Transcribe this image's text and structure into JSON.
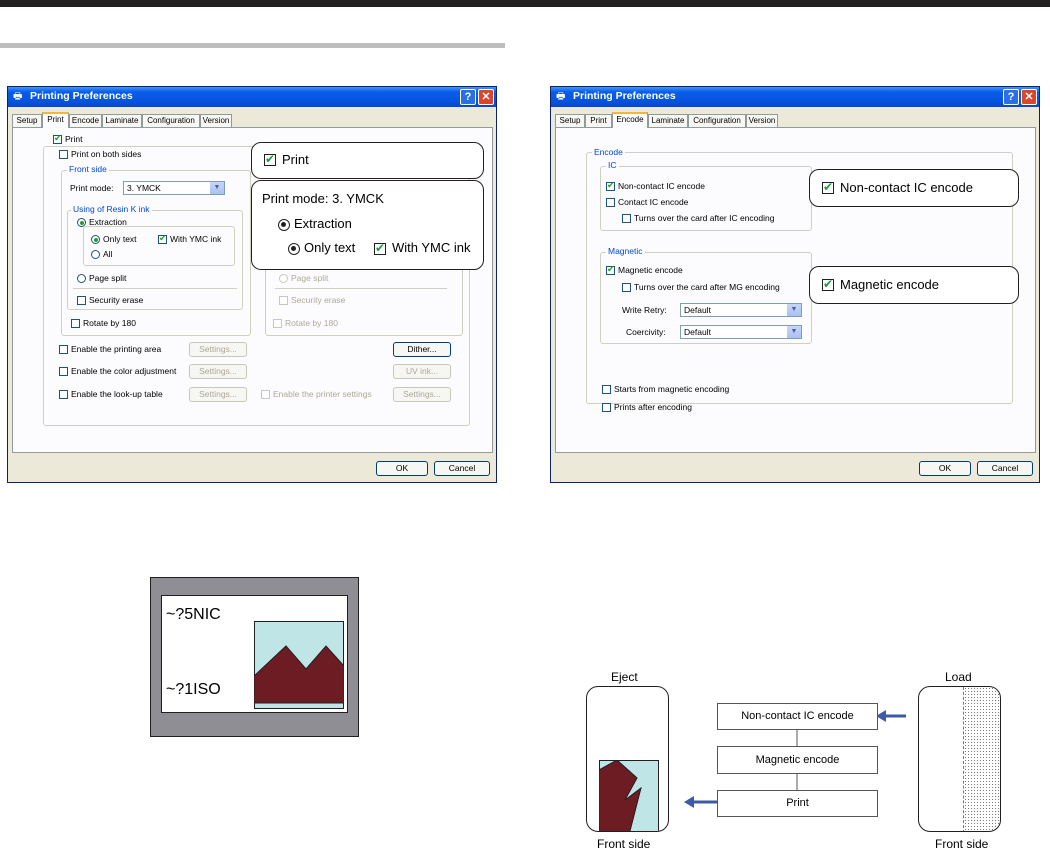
{
  "dialog_title": "Printing Preferences",
  "tabs": [
    "Setup",
    "Print",
    "Encode",
    "Laminate",
    "Configuration",
    "Version"
  ],
  "print_dialog": {
    "print": "Print",
    "print_both_sides": "Print on both sides",
    "front_side": "Front side",
    "print_mode_label": "Print mode:",
    "print_mode_value": "3. YMCK",
    "resin_group": "Using of Resin K ink",
    "extraction": "Extraction",
    "only_text": "Only text",
    "with_ymc": "With YMC ink",
    "all": "All",
    "page_split": "Page split",
    "security_erase": "Security erase",
    "rotate": "Rotate by 180",
    "enable_printing_area": "Enable the printing area",
    "enable_color_adjustment": "Enable the color adjustment",
    "enable_lookup": "Enable the look-up table",
    "enable_printer_settings": "Enable the printer settings",
    "settings": "Settings...",
    "dither": "Dither...",
    "uv_ink": "UV ink..."
  },
  "encode_dialog": {
    "encode_group": "Encode",
    "ic_group": "IC",
    "non_contact_ic": "Non-contact IC encode",
    "contact_ic": "Contact IC encode",
    "turns_ic": "Turns over the card after IC encoding",
    "magnetic_group": "Magnetic",
    "magnetic_encode": "Magnetic encode",
    "turns_mg": "Turns over the card after MG encoding",
    "write_retry_label": "Write Retry:",
    "write_retry_value": "Default",
    "coercivity_label": "Coercivity:",
    "coercivity_value": "Default",
    "starts_magnetic": "Starts from magnetic encoding",
    "prints_after": "Prints after encoding"
  },
  "buttons": {
    "ok": "OK",
    "cancel": "Cancel"
  },
  "callouts": {
    "print": "Print",
    "print_mode": "Print mode:  3. YMCK",
    "extraction": "Extraction",
    "only_text": "Only text",
    "with_ymc": "With YMC ink",
    "non_contact_ic": "Non-contact IC encode",
    "magnetic_encode": "Magnetic encode"
  },
  "card_sample": {
    "line1": "~?5NIC",
    "line2": "~?1ISO"
  },
  "flow": {
    "eject": "Eject",
    "load": "Load",
    "front_side_left": "Front side",
    "front_side_right": "Front side",
    "steps": [
      "Non-contact IC encode",
      "Magnetic encode",
      "Print"
    ]
  },
  "colors": {
    "card_bg": "#bfe5e6",
    "mountain": "#6e1c24",
    "frame": "#8e8e94"
  }
}
